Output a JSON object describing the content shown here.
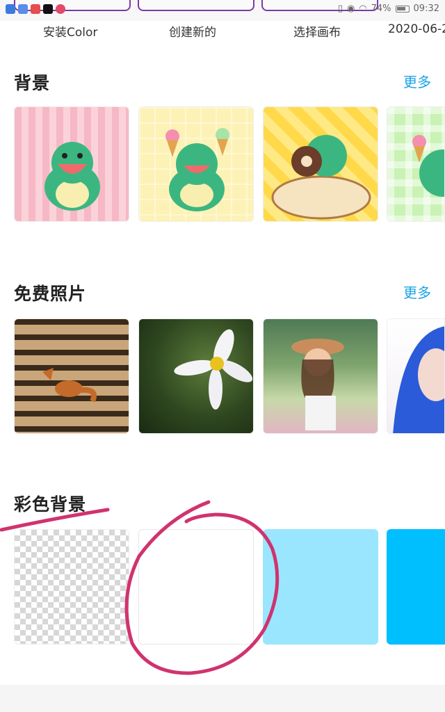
{
  "status_bar": {
    "battery": "74%",
    "time": "09:32"
  },
  "template_tabs": [
    {
      "label": "安装Color"
    },
    {
      "label": "创建新的"
    },
    {
      "label": "选择画布"
    },
    {
      "label": "2020-06-2"
    }
  ],
  "sections": {
    "backgrounds": {
      "title": "背景",
      "more": "更多"
    },
    "free_photos": {
      "title": "免费照片",
      "more": "更多"
    },
    "color_backgrounds": {
      "title": "彩色背景"
    }
  },
  "colors": {
    "accent": "#1aa3e6",
    "annotation": "#d0336e",
    "light_blue": "#9ae6ff",
    "blue": "#00bfff"
  }
}
